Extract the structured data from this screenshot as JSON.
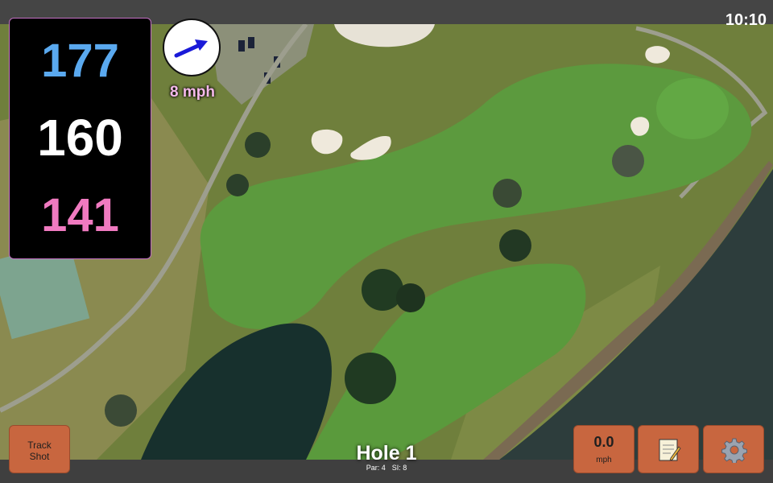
{
  "status": {
    "time": "10:10"
  },
  "distances": {
    "back": "177",
    "middle": "160",
    "front": "141",
    "colors": {
      "back": "#5aa9ef",
      "middle": "#ffffff",
      "front": "#f07ac0"
    }
  },
  "wind": {
    "speed_label": "8 mph",
    "direction_icon": "arrow-northeast-icon",
    "arrow_color": "#1a1ad8",
    "label_color": "#f5b9ea"
  },
  "hole": {
    "title": "Hole 1",
    "par": "Par: 4",
    "si": "SI: 8"
  },
  "buttons": {
    "track_shot": [
      "Track",
      "Shot"
    ],
    "wind_value": "0.0",
    "wind_unit": "mph",
    "notes_icon": "notepad-icon",
    "settings_icon": "gear-icon",
    "accent": "#c8663f"
  }
}
